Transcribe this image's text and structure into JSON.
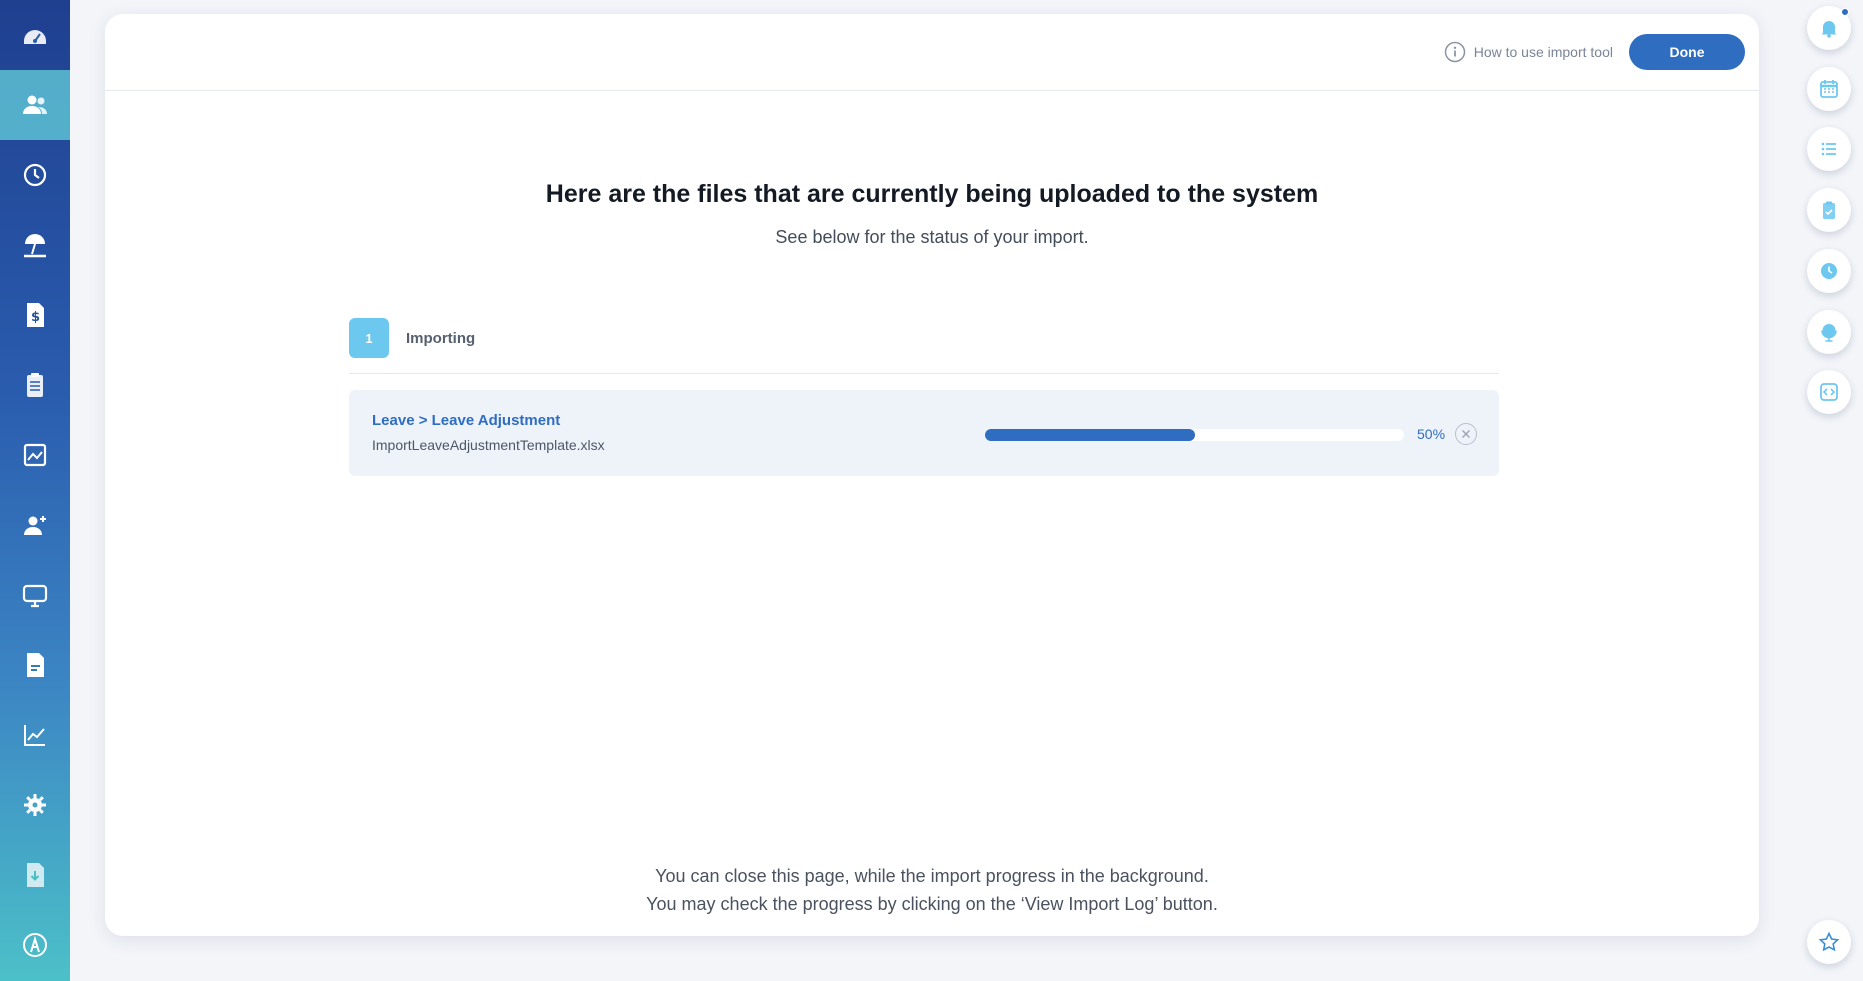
{
  "header": {
    "help_link": "How to use import tool",
    "done_label": "Done"
  },
  "main": {
    "title": "Here are the files that are currently being uploaded to the system",
    "subtitle": "See below for the status of your import.",
    "step": {
      "number": "1",
      "label": "Importing"
    },
    "file": {
      "path": "Leave > Leave Adjustment",
      "name": "ImportLeaveAdjustmentTemplate.xlsx",
      "progress": 0.5,
      "progress_label": "50%"
    },
    "footer_line1": "You can close this page, while the import progress in the background.",
    "footer_line2": "You may check the progress by clicking on the ‘View Import Log’ button."
  },
  "sidebar": {
    "items": [
      {
        "icon": "dashboard-icon"
      },
      {
        "icon": "people-icon",
        "active": true
      },
      {
        "icon": "history-icon"
      },
      {
        "icon": "beach-umbrella-icon"
      },
      {
        "icon": "payroll-document-icon"
      },
      {
        "icon": "clipboard-icon"
      },
      {
        "icon": "image-chart-icon"
      },
      {
        "icon": "add-user-icon"
      },
      {
        "icon": "monitor-icon"
      },
      {
        "icon": "document-icon"
      },
      {
        "icon": "line-chart-icon"
      },
      {
        "icon": "settings-gear-icon"
      },
      {
        "icon": "file-download-icon"
      },
      {
        "icon": "app-logo-icon"
      }
    ]
  },
  "right_rail": {
    "items": [
      {
        "icon": "bell-icon"
      },
      {
        "icon": "calendar-icon"
      },
      {
        "icon": "list-icon"
      },
      {
        "icon": "clipboard-check-icon"
      },
      {
        "icon": "clock-icon"
      },
      {
        "icon": "globe-icon"
      },
      {
        "icon": "code-icon"
      },
      {
        "icon": "star-icon"
      }
    ]
  },
  "colors": {
    "primary": "#2f6dc1",
    "accent_light": "#6cc8ef",
    "sidebar_active": "#66d2dc"
  }
}
